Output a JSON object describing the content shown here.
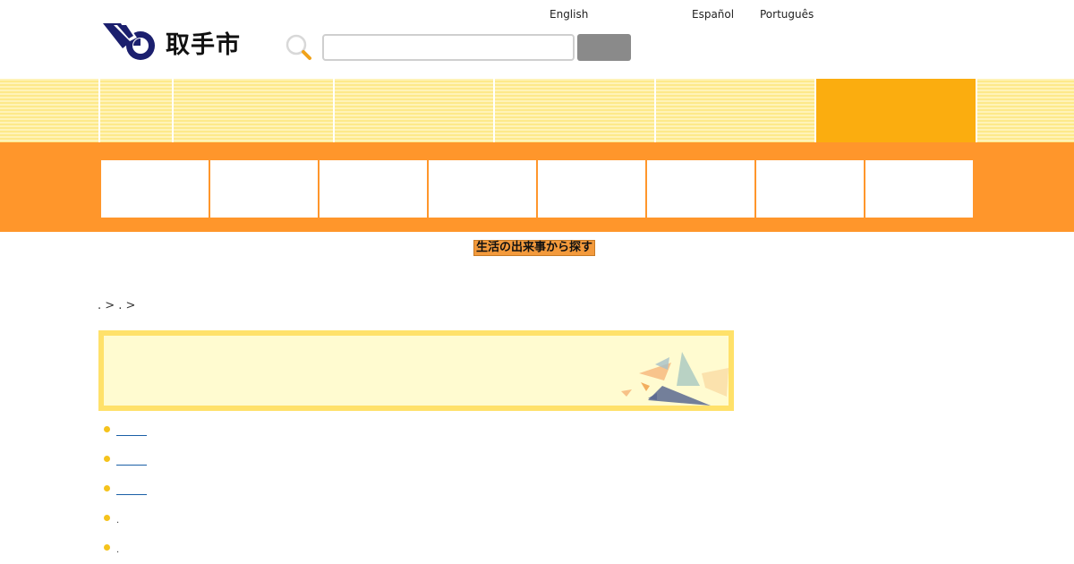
{
  "header": {
    "logo_text": "取手市",
    "search": {
      "placeholder": "",
      "value": "",
      "button_label": ""
    },
    "languages": [
      "English",
      "Español",
      "Português"
    ]
  },
  "global_nav": {
    "items": [
      "",
      "",
      "",
      "",
      "",
      "",
      ""
    ],
    "active_index": 5
  },
  "sub_nav": {
    "tiles": [
      "",
      "",
      "",
      "",
      "",
      "",
      "",
      ""
    ]
  },
  "section_label": "生活の出来事から探す",
  "breadcrumb": ". > . >",
  "banner": {
    "title": ""
  },
  "links": [
    {
      "label": ""
    },
    {
      "label": ""
    },
    {
      "label": ""
    },
    {
      "label": "."
    },
    {
      "label": "."
    }
  ],
  "colors": {
    "nav_stripe": "#fde98a",
    "nav_active": "#fbad0f",
    "subnav_bg": "#ff962b",
    "banner_bg": "#fffbd0",
    "banner_border": "#ffe16a",
    "logo_navy": "#1b1f6e"
  }
}
